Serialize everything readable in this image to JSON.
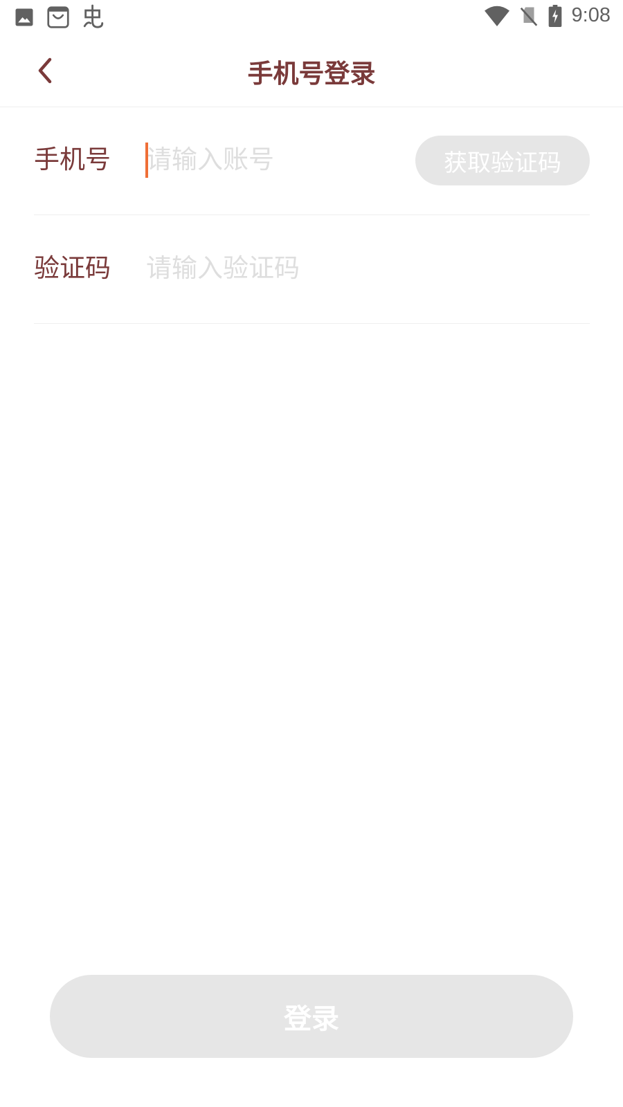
{
  "status_bar": {
    "time": "9:08",
    "left_icons": [
      "image-icon",
      "shopping-bag-icon",
      "app-logo-icon"
    ],
    "right_icons": [
      "wifi-icon",
      "no-sim-icon",
      "battery-charging-icon"
    ]
  },
  "header": {
    "back_icon": "chevron-left-icon",
    "title": "手机号登录"
  },
  "form": {
    "phone": {
      "label": "手机号",
      "placeholder": "请输入账号",
      "value": ""
    },
    "code_button_label": "获取验证码",
    "code": {
      "label": "验证码",
      "placeholder": "请输入验证码",
      "value": ""
    }
  },
  "login_button_label": "登录",
  "colors": {
    "accent_text": "#7a3a3a",
    "caret": "#ef6f37",
    "disabled_button": "#e6e6e6",
    "placeholder": "#dedede"
  }
}
